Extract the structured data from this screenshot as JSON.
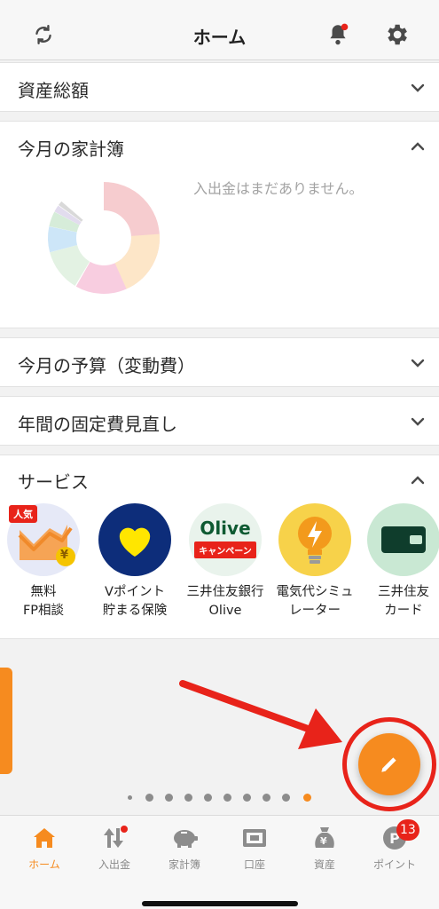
{
  "header": {
    "title": "ホーム",
    "sync_icon": "sync-icon",
    "bell_icon": "bell-icon",
    "settings_icon": "gear-icon"
  },
  "sections": {
    "assets": {
      "title": "資産総額"
    },
    "household": {
      "title": "今月の家計簿",
      "empty_message": "入出金はまだありません。"
    },
    "budget": {
      "title": "今月の予算（変動費）"
    },
    "fixed": {
      "title": "年間の固定費見直し"
    },
    "services": {
      "title": "サービス",
      "items": [
        {
          "label": "無料\nFP相談",
          "badge": "人気",
          "coin": "¥"
        },
        {
          "label": "Vポイント\n貯まる保険"
        },
        {
          "label": "三井住友銀行\nOlive",
          "logo_text": "Olive",
          "ribbon": "キャンペーン"
        },
        {
          "label": "電気代シミュ\nレーター"
        },
        {
          "label": "三井住友\nカード"
        }
      ]
    }
  },
  "carousel": {
    "page_count": 10,
    "active_index": 9
  },
  "tabs": [
    {
      "label": "ホーム",
      "icon": "home-icon",
      "active": true
    },
    {
      "label": "入出金",
      "icon": "transfer-icon"
    },
    {
      "label": "家計簿",
      "icon": "piggy-bank-icon"
    },
    {
      "label": "口座",
      "icon": "wallet-icon"
    },
    {
      "label": "資産",
      "icon": "money-bag-icon",
      "icon_text": "¥"
    },
    {
      "label": "ポイント",
      "icon": "point-icon",
      "icon_text": "P",
      "badge": "13"
    }
  ],
  "colors": {
    "accent": "#f68b1f",
    "alert": "#e8231a",
    "brand_green": "#0e8a3f"
  }
}
